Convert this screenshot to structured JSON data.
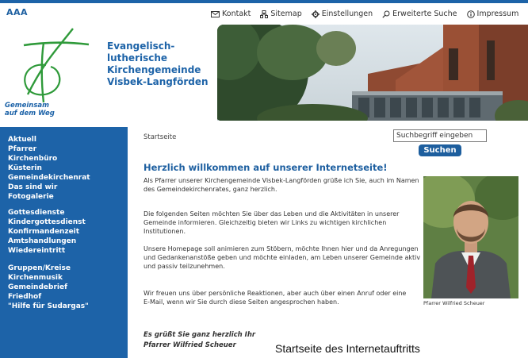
{
  "top": {
    "font_size_control": "AAA",
    "links": {
      "kontakt": "Kontakt",
      "sitemap": "Sitemap",
      "einstellungen": "Einstellungen",
      "erweiterte_suche": "Erweiterte Suche",
      "impressum": "Impressum"
    }
  },
  "logo": {
    "title_line1": "Evangelisch-lutherische",
    "title_line2": "Kirchengemeinde",
    "title_line3": "Visbek-Langförden",
    "motto_line1": "Gemeinsam",
    "motto_line2": "auf dem Weg"
  },
  "sidebar": {
    "items": [
      "Aktuell",
      "Pfarrer",
      "Kirchenbüro",
      "Küsterin",
      "Gemeindekirchenrat",
      "Das sind wir",
      "Fotogalerie",
      "Gottesdienste",
      "Kindergottesdienst",
      "Konfirmandenzeit",
      "Amtshandlungen",
      "Wiedereintritt",
      "Gruppen/Kreise",
      "Kirchenmusik",
      "Gemeindebrief",
      "Friedhof",
      "\"Hilfe für Sudargas\""
    ]
  },
  "main": {
    "breadcrumb": "Startseite",
    "search_value": "Suchbegriff eingeben",
    "search_button": "Suchen",
    "headline": "Herzlich willkommen auf unserer Internetseite!",
    "paragraphs": [
      "Als Pfarrer unserer Kirchengemeinde Visbek-Langförden grüße ich Sie, auch im Namen des Gemeindekirchenrates, ganz herzlich.",
      "Die folgenden Seiten möchten Sie über das Leben und die Aktivitäten in unserer Gemeinde informieren. Gleichzeitig bieten wir Links zu wichtigen kirchlichen Institutionen.",
      "Unsere Homepage soll animieren zum Stöbern, möchte Ihnen hier und da Anregungen und Gedankenanstöße geben und möchte einladen, am Leben unserer Gemeinde aktiv und passiv teilzunehmen.",
      "Wir freuen uns über persönliche Reaktionen, aber auch über einen Anruf oder eine E-Mail, wenn wir Sie durch diese Seiten angesprochen haben."
    ],
    "greeting_line1": "Es grüßt Sie ganz herzlich Ihr",
    "greeting_line2": "Pfarrer Wilfried Scheuer",
    "portrait_caption": "Pfarrer Wilfried Scheuer"
  },
  "figure_caption": "Startseite des Internetauftritts",
  "colors": {
    "brand_blue": "#1d63a8",
    "logo_green": "#2f9a3a"
  }
}
